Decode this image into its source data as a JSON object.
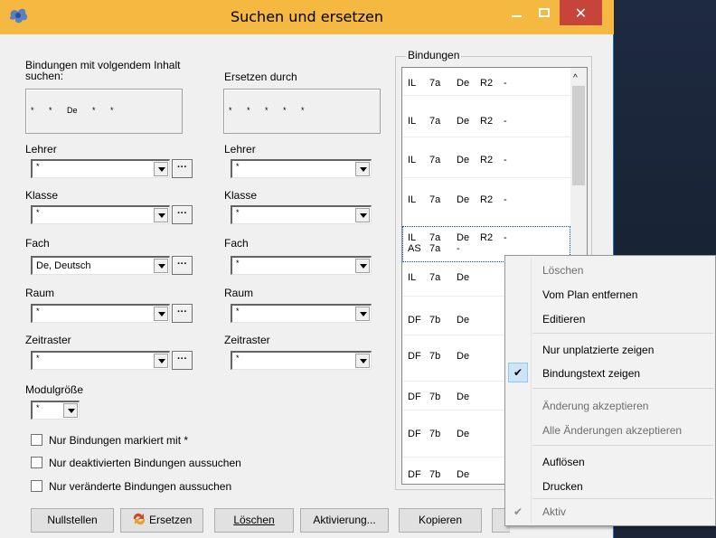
{
  "window": {
    "title": "Suchen und ersetzen",
    "close_glyph": "✕",
    "accent_color": "#f5b942",
    "close_color": "#c7443b"
  },
  "search": {
    "label": "Bindungen mit volgendem Inhalt suchen:",
    "pattern": "* * De * *"
  },
  "replace": {
    "label": "Ersetzen durch",
    "pattern": "* * * * *"
  },
  "fields_left": {
    "lehrer": {
      "label": "Lehrer",
      "value": "*"
    },
    "klasse": {
      "label": "Klasse",
      "value": "*"
    },
    "fach": {
      "label": "Fach",
      "value": "De, Deutsch"
    },
    "raum": {
      "label": "Raum",
      "value": "*"
    },
    "zeitraster": {
      "label": "Zeitraster",
      "value": "*"
    }
  },
  "fields_right": {
    "lehrer": {
      "label": "Lehrer",
      "value": "*"
    },
    "klasse": {
      "label": "Klasse",
      "value": "*"
    },
    "fach": {
      "label": "Fach",
      "value": "*"
    },
    "raum": {
      "label": "Raum",
      "value": "*"
    },
    "zeitraster": {
      "label": "Zeitraster",
      "value": "*"
    }
  },
  "dots_label": "···",
  "modulgroesse": {
    "label": "Modulgröße",
    "value": "*"
  },
  "checkboxes": [
    "Nur Bindungen markiert mit *",
    "Nur deaktivierten Bindungen aussuchen",
    "Nur veränderte Bindungen aussuchen"
  ],
  "buttons": {
    "nullstellen": "Nullstellen",
    "ersetzen": "Ersetzen",
    "loeschen": "Löschen",
    "aktivierung": "Aktivierung...",
    "kopieren": "Kopieren"
  },
  "bindungen": {
    "label": "Bindungen",
    "rows": [
      [
        "IL",
        "7a",
        "De",
        "R2",
        "-"
      ],
      [
        "IL",
        "7a",
        "De",
        "R2",
        "-"
      ],
      [
        "IL",
        "7a",
        "De",
        "R2",
        "-"
      ],
      [
        "IL",
        "7a",
        "De",
        "R2",
        "-"
      ],
      [
        "IL",
        "7a",
        "De",
        "R2",
        "-"
      ],
      [
        "AS",
        "7a",
        "-",
        "",
        ""
      ],
      [
        "IL",
        "7a",
        "De",
        "",
        ""
      ],
      [
        "DF",
        "7b",
        "De",
        "",
        ""
      ],
      [
        "DF",
        "7b",
        "De",
        "",
        ""
      ],
      [
        "DF",
        "7b",
        "De",
        "",
        ""
      ],
      [
        "DF",
        "7b",
        "De",
        "",
        ""
      ],
      [
        "DF",
        "7b",
        "De",
        "",
        ""
      ]
    ]
  },
  "context_menu": {
    "items": [
      {
        "label": "Löschen",
        "disabled": true
      },
      {
        "label": "Vom Plan entfernen",
        "disabled": false
      },
      {
        "label": "Editieren",
        "disabled": false
      },
      {
        "label": "Nur unplatzierte zeigen",
        "disabled": false
      },
      {
        "label": "Bindungstext zeigen",
        "disabled": false,
        "checked": true
      },
      {
        "label": "Änderung akzeptieren",
        "disabled": true
      },
      {
        "label": "Alle Änderungen akzeptieren",
        "disabled": true
      },
      {
        "label": "Auflösen",
        "disabled": false
      },
      {
        "label": "Drucken",
        "disabled": false
      },
      {
        "label": "Aktiv",
        "disabled": true,
        "checked": true
      }
    ],
    "check_glyph": "✔"
  }
}
